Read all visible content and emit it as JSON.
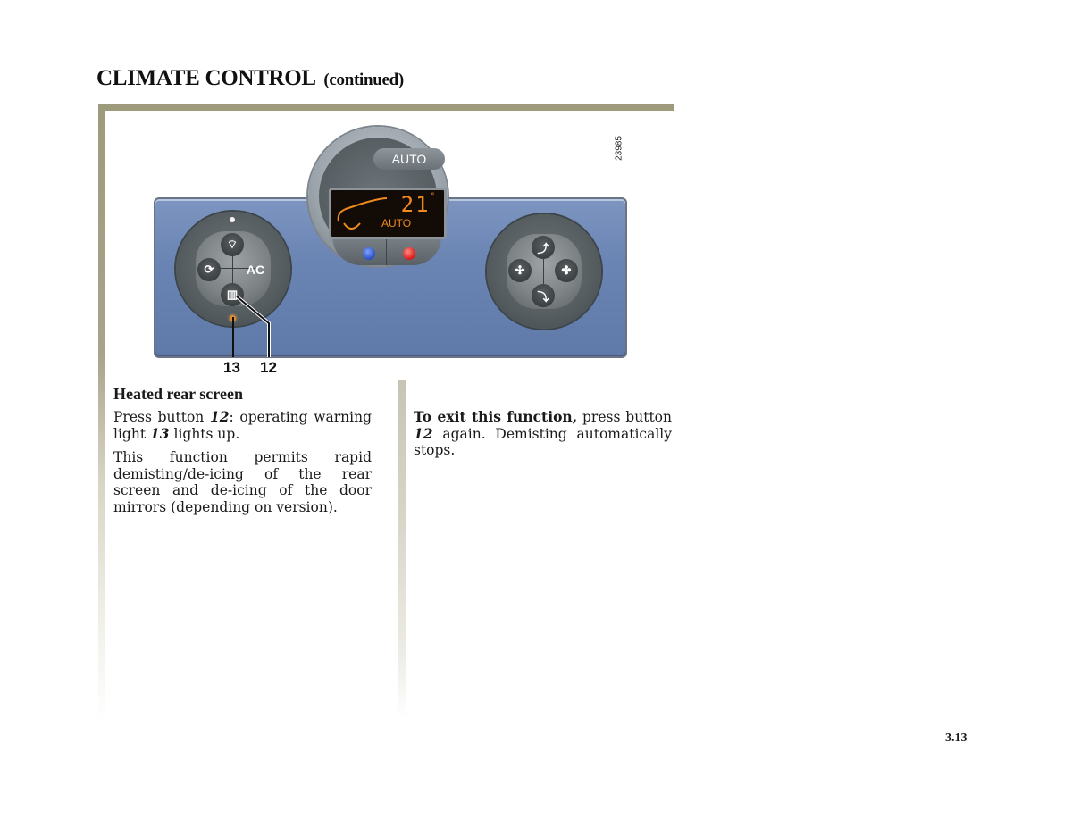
{
  "header": {
    "title": "CLIMATE CONTROL",
    "subtitle": "(continued)"
  },
  "figure": {
    "code": "23985",
    "center_control": {
      "auto_button_label": "AUTO",
      "display": {
        "temperature": "21",
        "unit": "°",
        "mode": "AUTO",
        "color": "#f08a1e"
      },
      "temp_down_color": "#2a4fc0",
      "temp_up_color": "#d81818"
    },
    "left_control": {
      "buttons": [
        {
          "name": "windscreen-demist-icon",
          "label": "⌔"
        },
        {
          "name": "recirculation-icon",
          "label": "⟳"
        },
        {
          "name": "ac-button",
          "label": "AC"
        },
        {
          "name": "rear-screen-demist-icon",
          "label": "▥"
        }
      ]
    },
    "right_control": {
      "buttons": [
        {
          "name": "air-distribution-up-icon",
          "label": "⤴"
        },
        {
          "name": "fan-low-icon",
          "label": "✣"
        },
        {
          "name": "fan-high-icon",
          "label": "✤"
        },
        {
          "name": "air-distribution-down-icon",
          "label": "⤵"
        }
      ]
    },
    "callouts": [
      "13",
      "12"
    ]
  },
  "section": {
    "heading": "Heated rear screen",
    "p1": {
      "a": "Press button ",
      "n1": "12",
      "b": ": operating warning light ",
      "n2": "13",
      "c": " lights up."
    },
    "p2": "This function permits rapid demisting/de-icing of the rear screen and de-icing of the door mirrors (depending on version).",
    "p3": {
      "bold": "To exit this function,",
      "a": " press button ",
      "n": "12",
      "b": " again. Demisting automatically stops."
    }
  },
  "page_number": "3.13"
}
